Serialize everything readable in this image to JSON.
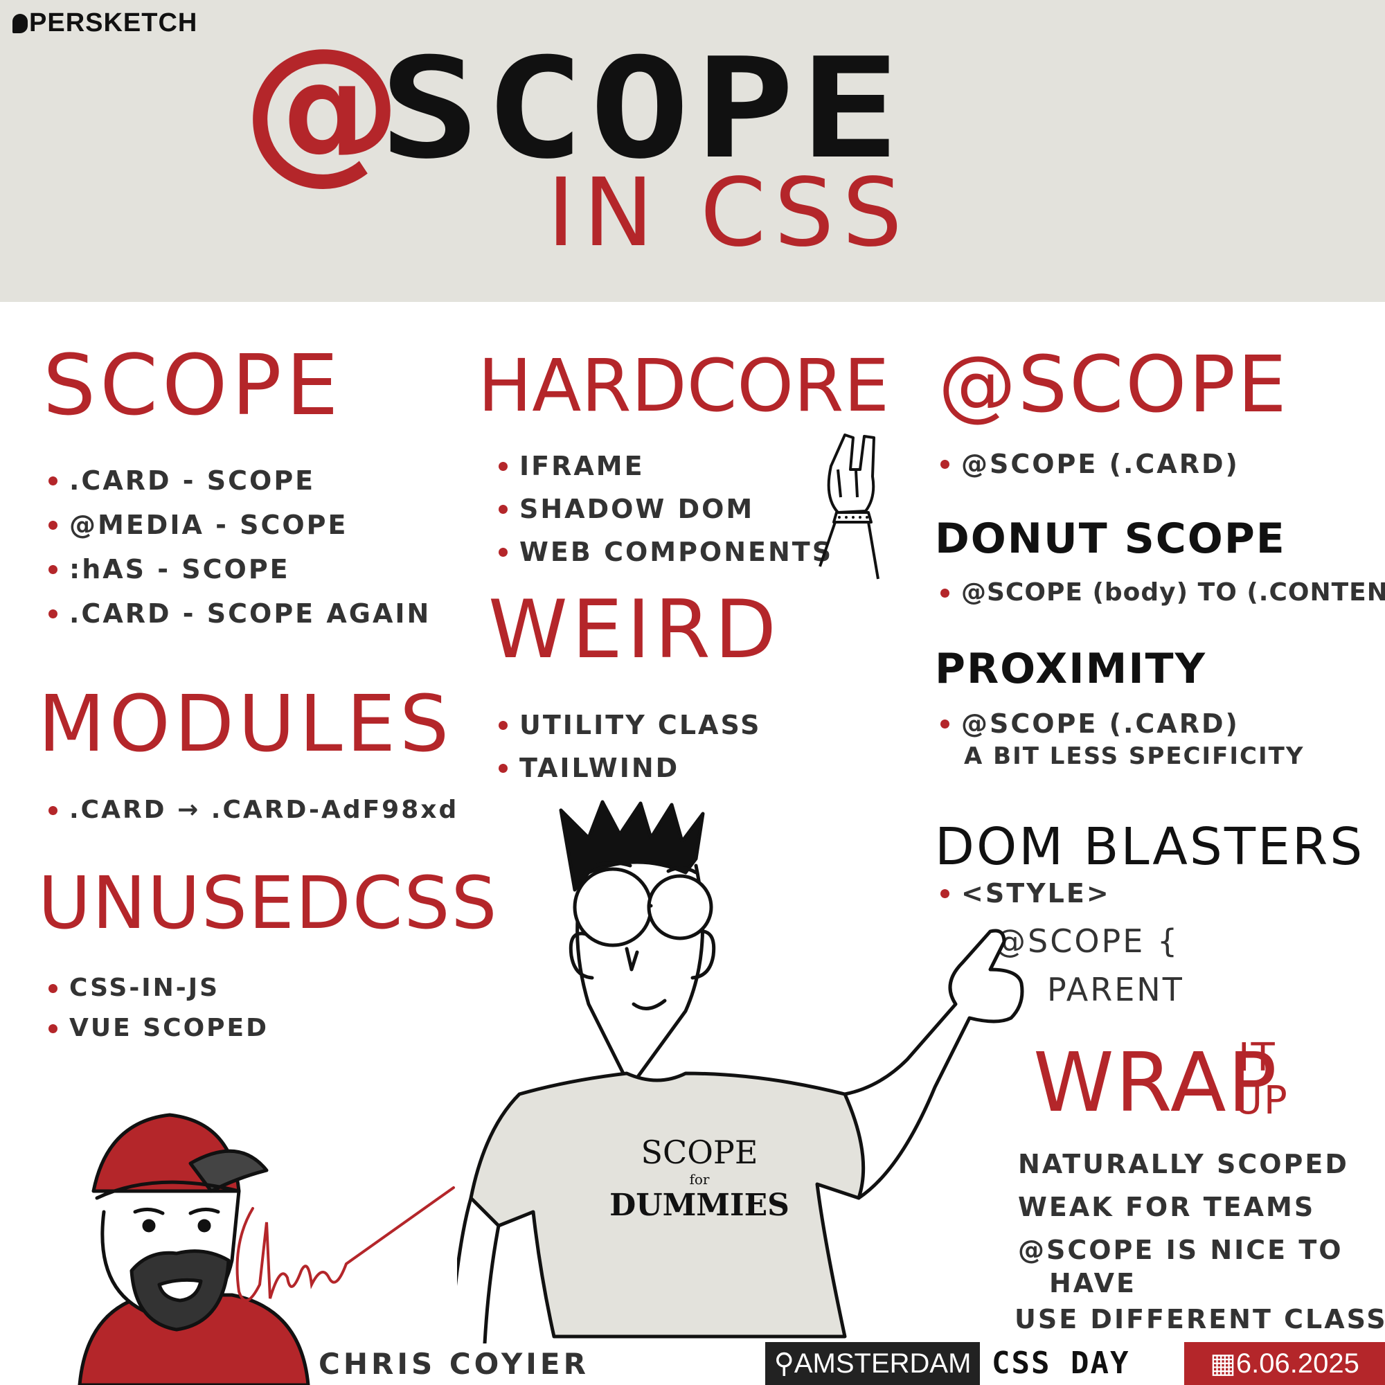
{
  "header": {
    "brand": "PERSKETCH",
    "title_at": "@",
    "title_main": "SCOPE",
    "subtitle": "IN CSS"
  },
  "scope": {
    "heading": "SCOPE",
    "items": [
      ".CARD - SCOPE",
      "@MEDIA - SCOPE",
      ":hAS - SCOPE",
      ".CARD - SCOPE AGAIN"
    ]
  },
  "modules": {
    "heading": "MODULES",
    "items": [
      ".CARD → .CARD-AdF98xd"
    ]
  },
  "unused": {
    "heading": "UNUSEDCSS",
    "items": [
      "CSS-IN-JS",
      "VUE SCOPED"
    ]
  },
  "hardcore": {
    "heading": "HARDCORE",
    "items": [
      "IFRAME",
      "SHADOW DOM",
      "WEB COMPONENTS"
    ]
  },
  "weird": {
    "heading": "WEIRD",
    "items": [
      "UTILITY CLASS",
      "TAILWIND"
    ]
  },
  "at_scope": {
    "heading": "@SCOPE",
    "items": [
      "@SCOPE (.CARD)"
    ]
  },
  "donut": {
    "heading": "DONUT SCOPE",
    "items": [
      "@SCOPE (body) TO (.CONTENT)"
    ]
  },
  "proximity": {
    "heading": "PROXIMITY",
    "items": [
      "@SCOPE (.CARD)"
    ],
    "note": "A BIT LESS SPECIFICITY"
  },
  "dom_blasters": {
    "heading": "DOM BLASTERS",
    "items": [
      "<STYLE>"
    ],
    "code_line1": "@SCOPE {",
    "code_line2": "PARENT"
  },
  "wrap": {
    "heading_main": "WRAP",
    "heading_top": "IT",
    "heading_bottom": "UP",
    "lines": [
      "NATURALLY SCOPED",
      "WEAK FOR TEAMS",
      "@SCOPE IS NICE TO",
      "HAVE",
      "USE DIFFERENT CLASS"
    ]
  },
  "shirt": {
    "line1": "SCOPE",
    "line2": "for",
    "line3": "DUMMIES"
  },
  "footer": {
    "speaker": "CHRIS COYIER",
    "location": "AMSTERDAM",
    "brand": "CSS DAY",
    "date": "6.06.2025"
  },
  "colors": {
    "accent": "#b4262a",
    "header_bg": "#e3e2dc",
    "ink": "#111111"
  }
}
